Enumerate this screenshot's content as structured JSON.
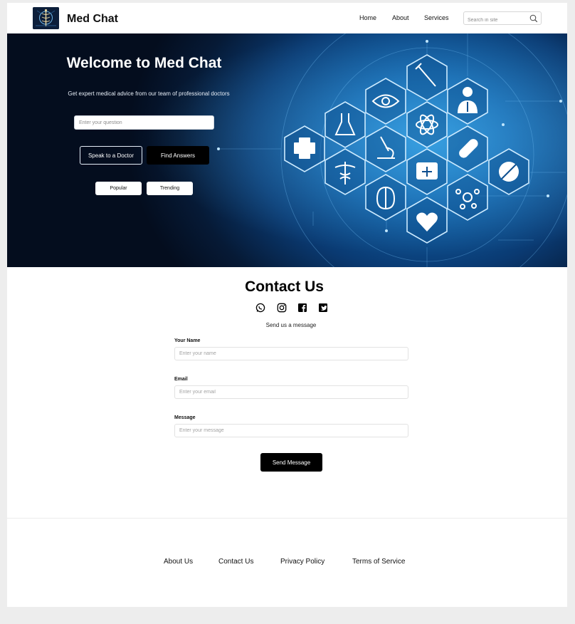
{
  "header": {
    "brand": "Med Chat",
    "nav": [
      "Home",
      "About",
      "Services"
    ],
    "search_placeholder": "Search in site",
    "logo_icon": "caduceus-logo-icon"
  },
  "hero": {
    "title": "Welcome to Med Chat",
    "subtitle": "Get expert medical advice from our team of professional doctors",
    "question_placeholder": "Enter your question",
    "primary_outline_label": "Speak to a Doctor",
    "primary_dark_label": "Find Answers",
    "pills": [
      "Popular",
      "Trending"
    ]
  },
  "contact": {
    "title": "Contact Us",
    "social_icons": [
      "whatsapp-icon",
      "instagram-icon",
      "facebook-icon",
      "twitter-icon"
    ],
    "subtitle": "Send us a message",
    "fields": [
      {
        "label": "Your Name",
        "placeholder": "Enter your name"
      },
      {
        "label": "Email",
        "placeholder": "Enter your email"
      },
      {
        "label": "Message",
        "placeholder": "Enter your message"
      }
    ],
    "submit_label": "Send Message"
  },
  "footer": {
    "links": [
      "About Us",
      "Contact Us",
      "Privacy Policy",
      "Terms of Service"
    ]
  },
  "colors": {
    "accent_dark": "#000000",
    "hero_blue": "#0f5fa6",
    "page_bg": "#ededed"
  }
}
